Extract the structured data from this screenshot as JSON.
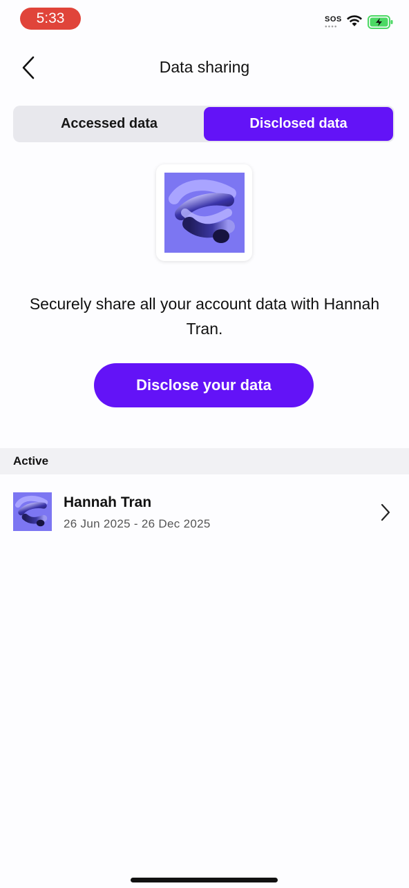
{
  "status_bar": {
    "time": "5:33",
    "sos": "SOS"
  },
  "nav": {
    "title": "Data sharing"
  },
  "tabs": [
    {
      "label": "Accessed data",
      "active": false
    },
    {
      "label": "Disclosed data",
      "active": true
    }
  ],
  "description": "Securely share all your account data with Hannah Tran.",
  "primary_button": "Disclose your data",
  "section": {
    "title": "Active",
    "items": [
      {
        "name": "Hannah Tran",
        "dates": "26 Jun 2025 - 26 Dec 2025"
      }
    ]
  },
  "colors": {
    "accent": "#6313f7",
    "time_pill": "#e0443a",
    "battery": "#4cd964"
  }
}
